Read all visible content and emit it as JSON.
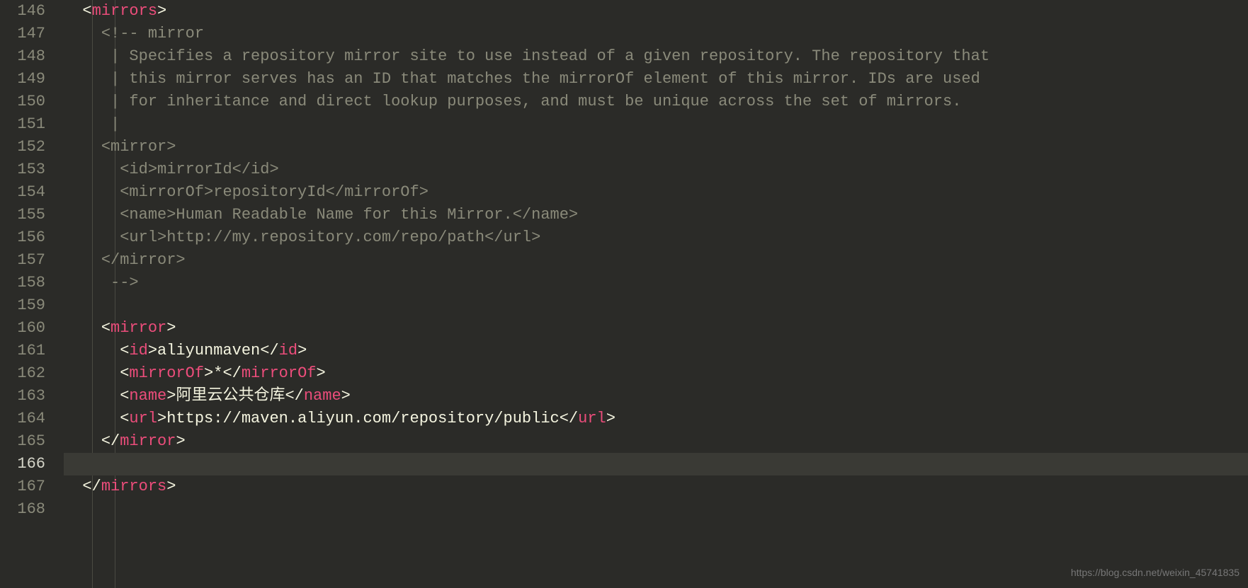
{
  "watermark": "https://blog.csdn.net/weixin_45741835",
  "lineStart": 146,
  "activeLine": 166,
  "code": {
    "l146": {
      "indent": "  ",
      "otag": "mirrors"
    },
    "l147": {
      "indent": "    ",
      "comment": "<!-- mirror"
    },
    "l148": {
      "indent": "     ",
      "comment": "| Specifies a repository mirror site to use instead of a given repository. The repository that"
    },
    "l149": {
      "indent": "     ",
      "comment": "| this mirror serves has an ID that matches the mirrorOf element of this mirror. IDs are used"
    },
    "l150": {
      "indent": "     ",
      "comment": "| for inheritance and direct lookup purposes, and must be unique across the set of mirrors."
    },
    "l151": {
      "indent": "     ",
      "comment": "|"
    },
    "l152": {
      "indent": "    ",
      "comment": "<mirror>"
    },
    "l153": {
      "indent": "      ",
      "comment": "<id>mirrorId</id>"
    },
    "l154": {
      "indent": "      ",
      "comment": "<mirrorOf>repositoryId</mirrorOf>"
    },
    "l155": {
      "indent": "      ",
      "comment": "<name>Human Readable Name for this Mirror.</name>"
    },
    "l156": {
      "indent": "      ",
      "comment": "<url>http://my.repository.com/repo/path</url>"
    },
    "l157": {
      "indent": "    ",
      "comment": "</mirror>"
    },
    "l158": {
      "indent": "     ",
      "comment": "-->"
    },
    "l160": {
      "indent": "    ",
      "otag": "mirror"
    },
    "l161": {
      "indent": "      ",
      "otag": "id",
      "text": "aliyunmaven",
      "ctag": "id"
    },
    "l162": {
      "indent": "      ",
      "otag": "mirrorOf",
      "text": "*",
      "ctag": "mirrorOf"
    },
    "l163": {
      "indent": "      ",
      "otag": "name",
      "text": "阿里云公共仓库",
      "ctag": "name"
    },
    "l164": {
      "indent": "      ",
      "otag": "url",
      "text": "https://maven.aliyun.com/repository/public",
      "ctag": "url"
    },
    "l165": {
      "indent": "    ",
      "ctag": "mirror"
    },
    "l167": {
      "indent": "  ",
      "ctag": "mirrors"
    }
  },
  "gutter": [
    "146",
    "147",
    "148",
    "149",
    "150",
    "151",
    "152",
    "153",
    "154",
    "155",
    "156",
    "157",
    "158",
    "159",
    "160",
    "161",
    "162",
    "163",
    "164",
    "165",
    "166",
    "167",
    "168"
  ]
}
